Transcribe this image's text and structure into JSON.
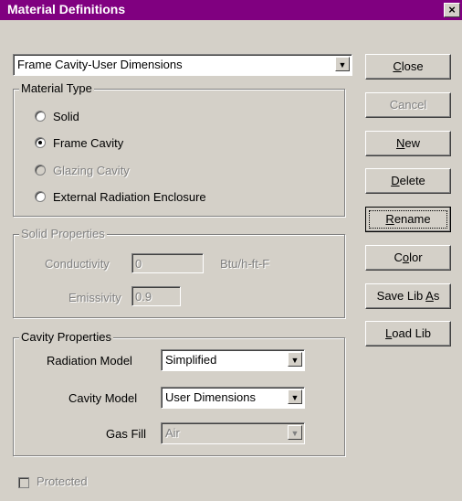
{
  "window": {
    "title": "Material Definitions",
    "close_glyph": "×"
  },
  "material_select": {
    "value": "Frame Cavity-User Dimensions"
  },
  "material_type": {
    "legend": "Material Type",
    "options": [
      {
        "label": "Solid",
        "selected": false,
        "enabled": true
      },
      {
        "label": "Frame Cavity",
        "selected": true,
        "enabled": true
      },
      {
        "label": "Glazing Cavity",
        "selected": false,
        "enabled": false
      },
      {
        "label": "External Radiation Enclosure",
        "selected": false,
        "enabled": true
      }
    ]
  },
  "solid_properties": {
    "legend": "Solid Properties",
    "conductivity_label": "Conductivity",
    "conductivity_value": "0",
    "conductivity_unit": "Btu/h-ft-F",
    "emissivity_label": "Emissivity",
    "emissivity_value": "0.9"
  },
  "cavity_properties": {
    "legend": "Cavity Properties",
    "radiation_model_label": "Radiation Model",
    "radiation_model_value": "Simplified",
    "cavity_model_label": "Cavity Model",
    "cavity_model_value": "User Dimensions",
    "gas_fill_label": "Gas Fill",
    "gas_fill_value": "Air"
  },
  "protected": {
    "label": "Protected",
    "checked": false
  },
  "buttons": {
    "close": {
      "pre": "",
      "acc": "C",
      "post": "lose"
    },
    "cancel": {
      "pre": "Cancel",
      "acc": "",
      "post": ""
    },
    "new": {
      "pre": "",
      "acc": "N",
      "post": "ew"
    },
    "delete": {
      "pre": "",
      "acc": "D",
      "post": "elete"
    },
    "rename": {
      "pre": "",
      "acc": "R",
      "post": "ename"
    },
    "color": {
      "pre": "C",
      "acc": "o",
      "post": "lor"
    },
    "save_lib_as": {
      "pre": "Save Lib ",
      "acc": "A",
      "post": "s"
    },
    "load_lib": {
      "pre": "",
      "acc": "L",
      "post": "oad Lib"
    }
  }
}
